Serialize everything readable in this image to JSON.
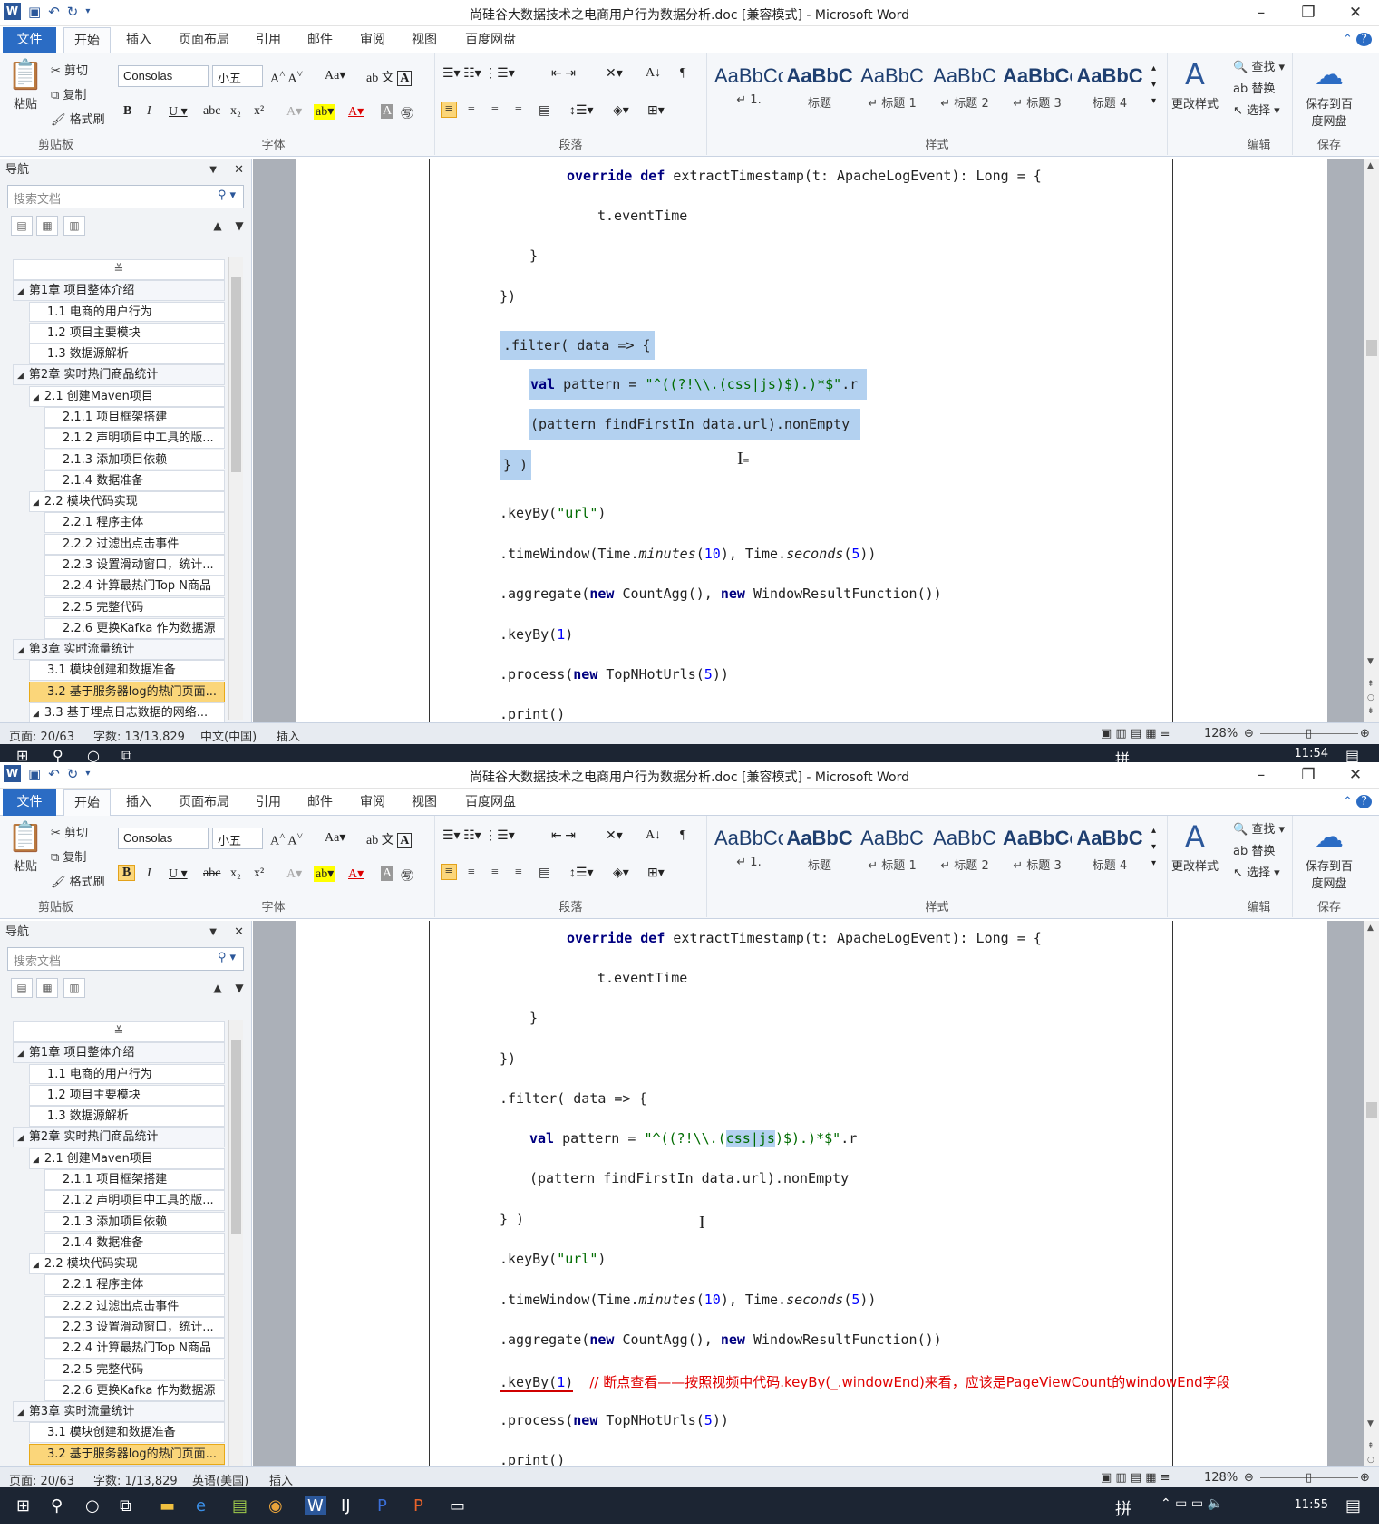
{
  "windows": [
    {
      "title": "尚硅谷大数据技术之电商用户行为数据分析.doc [兼容模式] - Microsoft Word",
      "tabs": [
        "文件",
        "开始",
        "插入",
        "页面布局",
        "引用",
        "邮件",
        "审阅",
        "视图",
        "百度网盘"
      ],
      "ribbon": {
        "clipboard": {
          "paste": "粘贴",
          "cut": "剪切",
          "copy": "复制",
          "format_painter": "格式刷",
          "label": "剪贴板"
        },
        "font": {
          "name": "Consolas",
          "size": "小五",
          "label": "字体"
        },
        "paragraph_label": "段落",
        "styles": [
          {
            "preview": "AaBbCcI",
            "label": "↵ 1."
          },
          {
            "preview": "AaBbC",
            "label": "标题"
          },
          {
            "preview": "AaBbC",
            "label": "↵ 标题 1"
          },
          {
            "preview": "AaBbC",
            "label": "↵ 标题 2"
          },
          {
            "preview": "AaBbCc",
            "label": "↵ 标题 3"
          },
          {
            "preview": "AaBbC",
            "label": "标题 4"
          }
        ],
        "change_styles": "更改样式",
        "styles_label": "样式",
        "editing": {
          "find": "查找",
          "replace": "替换",
          "select": "选择",
          "label": "编辑"
        },
        "save": {
          "btn": "保存到百度网盘",
          "label": "保存"
        }
      },
      "nav": {
        "title": "导航",
        "search_placeholder": "搜索文档",
        "items": [
          {
            "text": "第1章 项目整体介绍",
            "level": 1
          },
          {
            "text": "1.1 电商的用户行为",
            "level": 2
          },
          {
            "text": "1.2 项目主要模块",
            "level": 2
          },
          {
            "text": "1.3 数据源解析",
            "level": 2
          },
          {
            "text": "第2章 实时热门商品统计",
            "level": 1
          },
          {
            "text": "2.1 创建Maven项目",
            "level": 2
          },
          {
            "text": "2.1.1 项目框架搭建",
            "level": 3
          },
          {
            "text": "2.1.2 声明项目中工具的版...",
            "level": 3
          },
          {
            "text": "2.1.3 添加项目依赖",
            "level": 3
          },
          {
            "text": "2.1.4 数据准备",
            "level": 3
          },
          {
            "text": "2.2 模块代码实现",
            "level": 2
          },
          {
            "text": "2.2.1 程序主体",
            "level": 3
          },
          {
            "text": "2.2.2 过滤出点击事件",
            "level": 3
          },
          {
            "text": "2.2.3 设置滑动窗口，统计...",
            "level": 3
          },
          {
            "text": "2.2.4 计算最热门Top N商品",
            "level": 3
          },
          {
            "text": "2.2.5 完整代码",
            "level": 3
          },
          {
            "text": "2.2.6 更换Kafka 作为数据源",
            "level": 3
          },
          {
            "text": "第3章 实时流量统计",
            "level": 1
          },
          {
            "text": "3.1 模块创建和数据准备",
            "level": 2
          },
          {
            "text": "3.2 基于服务器log的热门页面...",
            "level": 2,
            "selected": true
          },
          {
            "text": "3.3 基于埋点日志数据的网络...",
            "level": 2
          }
        ]
      },
      "code": [
        "override def extractTimestamp(t: ApacheLogEvent): Long = {",
        "t.eventTime",
        "}",
        "})",
        ".filter( data => {",
        "val pattern = \"^((?!\\\\.(css|js)$).)*$\".r",
        "(pattern findFirstIn data.url).nonEmpty",
        "} )",
        ".keyBy(\"url\")",
        ".timeWindow(Time.minutes(10), Time.seconds(5))",
        ".aggregate(new CountAgg(), new WindowResultFunction())",
        ".keyBy(1)",
        ".process(new TopNHotUrls(5))",
        ".print()"
      ],
      "status": {
        "page": "页面: 20/63",
        "words": "字数: 13/13,829",
        "lang": "中文(中国)",
        "mode": "插入",
        "zoom": "128%"
      },
      "clock": "11:54"
    },
    {
      "title": "尚硅谷大数据技术之电商用户行为数据分析.doc [兼容模式] - Microsoft Word",
      "comment": "// 断点查看——按照视频中代码.keyBy(_.windowEnd)来看，应该是PageViewCount的windowEnd字段",
      "status": {
        "page": "页面: 20/63",
        "words": "字数: 1/13,829",
        "lang": "英语(美国)",
        "mode": "插入",
        "zoom": "128%"
      },
      "clock": "11:55"
    }
  ]
}
